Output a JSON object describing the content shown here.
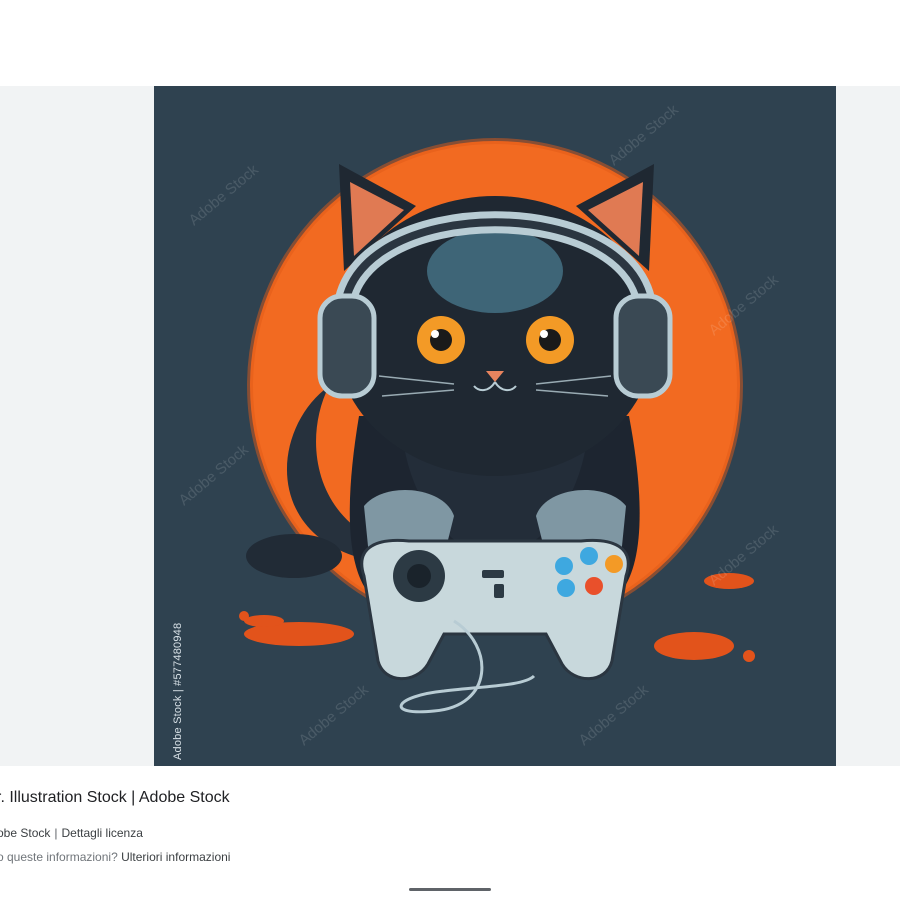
{
  "result": {
    "title": "r. Illustration Stock | Adobe Stock",
    "source_name": "obe Stock",
    "license_link": "Dettagli licenza",
    "info_question": "o queste informazioni?",
    "info_link": "Ulteriori informazioni"
  },
  "image": {
    "watermark_text": "Adobe Stock",
    "side_id": "Adobe Stock | #577480948",
    "background_color": "#2f4250",
    "accent_color": "#f26a21"
  }
}
